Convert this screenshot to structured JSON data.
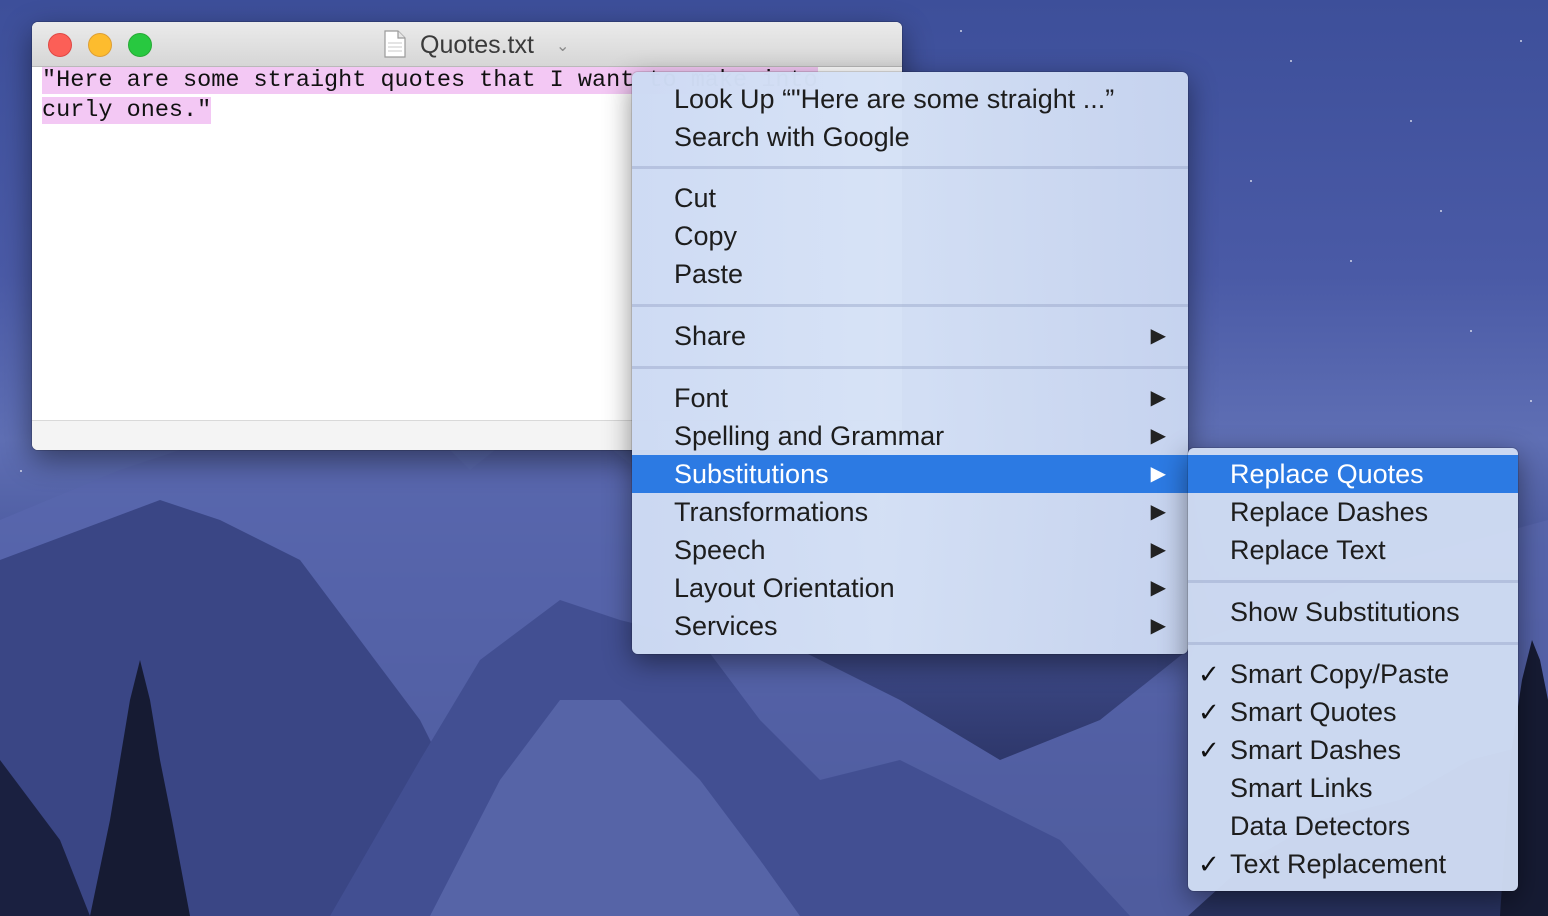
{
  "window": {
    "title": "Quotes.txt",
    "text_lines": [
      "\"Here are some straight quotes that I want to make into",
      "curly ones.\""
    ]
  },
  "context_menu": {
    "items": [
      {
        "label": "Look Up “\"Here are some straight ...”"
      },
      {
        "label": "Search with Google"
      },
      {
        "label": "Cut"
      },
      {
        "label": "Copy"
      },
      {
        "label": "Paste"
      },
      {
        "label": "Share",
        "submenu": true
      },
      {
        "label": "Font",
        "submenu": true
      },
      {
        "label": "Spelling and Grammar",
        "submenu": true
      },
      {
        "label": "Substitutions",
        "submenu": true,
        "highlighted": true
      },
      {
        "label": "Transformations",
        "submenu": true
      },
      {
        "label": "Speech",
        "submenu": true
      },
      {
        "label": "Layout Orientation",
        "submenu": true
      },
      {
        "label": "Services",
        "submenu": true
      }
    ],
    "arrow_glyph": "▶"
  },
  "substitutions_menu": {
    "items": [
      {
        "label": "Replace Quotes",
        "highlighted": true
      },
      {
        "label": "Replace Dashes"
      },
      {
        "label": "Replace Text"
      },
      {
        "label": "Show Substitutions"
      },
      {
        "label": "Smart Copy/Paste",
        "checked": true
      },
      {
        "label": "Smart Quotes",
        "checked": true
      },
      {
        "label": "Smart Dashes",
        "checked": true
      },
      {
        "label": "Smart Links",
        "checked": false
      },
      {
        "label": "Data Detectors",
        "checked": false
      },
      {
        "label": "Text Replacement",
        "checked": true
      }
    ],
    "check_glyph": "✓"
  },
  "colors": {
    "highlight": "#2c7ae3",
    "selection": "#f3c8f4",
    "close": "#fc5f57",
    "minimize": "#fdbc2e",
    "maximize": "#28c840"
  }
}
